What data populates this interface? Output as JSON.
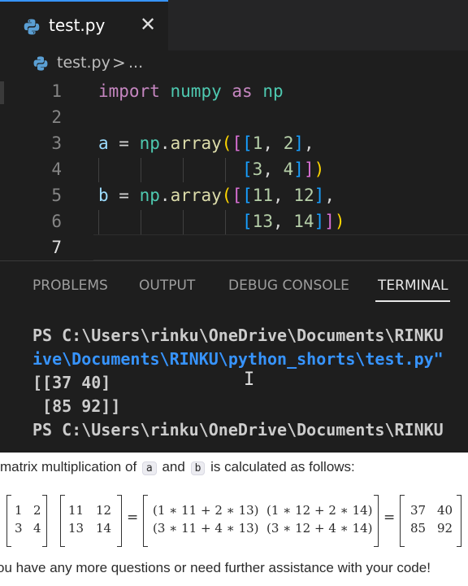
{
  "tab": {
    "filename": "test.py",
    "close_icon": "close-icon"
  },
  "breadcrumb": {
    "file": "test.py",
    "separator": ">",
    "rest": "..."
  },
  "editor": {
    "line_numbers": [
      "1",
      "2",
      "3",
      "4",
      "5",
      "6",
      "7"
    ],
    "lines": [
      "import numpy as np",
      "",
      "a = np.array([[1, 2],",
      "              [3, 4]])",
      "b = np.array([[11, 12],",
      "              [13, 14]])",
      ""
    ]
  },
  "panel": {
    "tabs": [
      "PROBLEMS",
      "OUTPUT",
      "DEBUG CONSOLE",
      "TERMINAL"
    ],
    "active_tab": "TERMINAL"
  },
  "terminal": {
    "lines": [
      "PS C:\\Users\\rinku\\OneDrive\\Documents\\RINKU",
      "ive\\Documents\\RINKU\\python_shorts\\test.py\"",
      "[[37 40]",
      " [85 92]]",
      "PS C:\\Users\\rinku\\OneDrive\\Documents\\RINKU"
    ]
  },
  "explanation": {
    "intro_pre": " matrix multiplication of",
    "var_a": "a",
    "intro_mid": "and",
    "var_b": "b",
    "intro_post": "is calculated as follows:",
    "matrix_a": [
      "1",
      "2",
      "3",
      "4"
    ],
    "matrix_b": [
      "11",
      "12",
      "13",
      "14"
    ],
    "expr": [
      "(1 ∗ 11 + 2 ∗ 13)",
      "(1 ∗ 12 + 2 ∗ 14)",
      "(3 ∗ 11 + 4 ∗ 13)",
      "(3 ∗ 12 + 4 ∗ 14)"
    ],
    "result": [
      "37",
      "40",
      "85",
      "92"
    ],
    "equals": "=",
    "closing": "ou have any more questions or need further assistance with your code!"
  }
}
